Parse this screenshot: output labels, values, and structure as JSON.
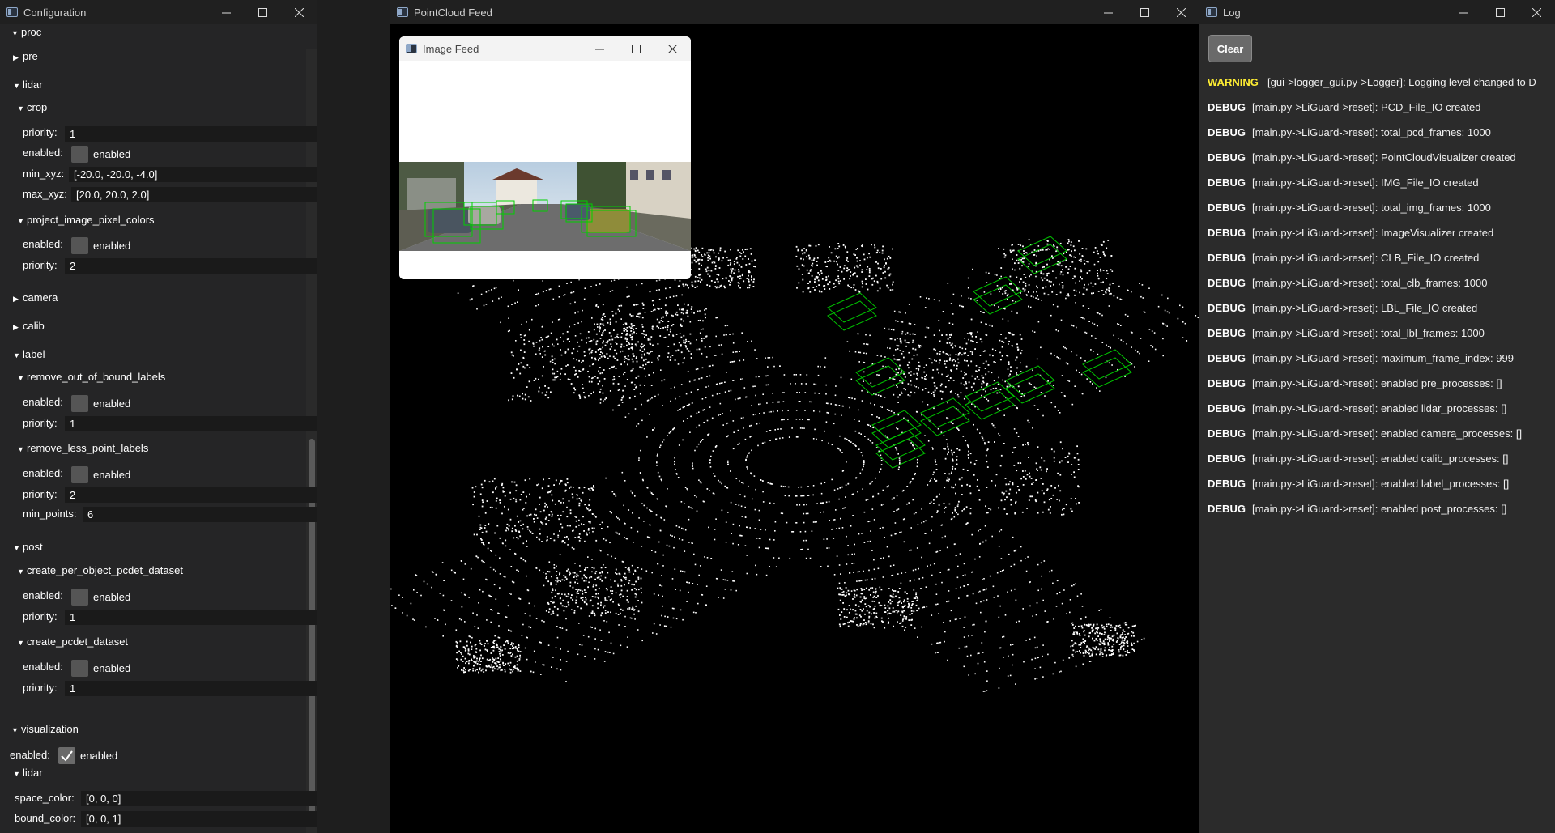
{
  "config_window": {
    "title": "Configuration",
    "sections": {
      "proc": "proc",
      "pre": "pre",
      "lidar": "lidar",
      "crop": "crop",
      "crop_priority_label": "priority:",
      "crop_priority": "1",
      "crop_enabled_label": "enabled:",
      "crop_enabled_text": "enabled",
      "min_xyz_label": "min_xyz:",
      "min_xyz": "[-20.0, -20.0, -4.0]",
      "max_xyz_label": "max_xyz:",
      "max_xyz": "[20.0, 20.0, 2.0]",
      "project_image_pixel_colors": "project_image_pixel_colors",
      "pipc_enabled_label": "enabled:",
      "pipc_enabled_text": "enabled",
      "pipc_priority_label": "priority:",
      "pipc_priority": "2",
      "camera": "camera",
      "calib": "calib",
      "label": "label",
      "remove_out_of_bound_labels": "remove_out_of_bound_labels",
      "roobl_enabled_label": "enabled:",
      "roobl_enabled_text": "enabled",
      "roobl_priority_label": "priority:",
      "roobl_priority": "1",
      "remove_less_point_labels": "remove_less_point_labels",
      "rlpl_enabled_label": "enabled:",
      "rlpl_enabled_text": "enabled",
      "rlpl_priority_label": "priority:",
      "rlpl_priority": "2",
      "min_points_label": "min_points:",
      "min_points": "6",
      "post": "post",
      "create_per_object_pcdet_dataset": "create_per_object_pcdet_dataset",
      "cpopd_enabled_label": "enabled:",
      "cpopd_enabled_text": "enabled",
      "cpopd_priority_label": "priority:",
      "cpopd_priority": "1",
      "create_pcdet_dataset": "create_pcdet_dataset",
      "cpd_enabled_label": "enabled:",
      "cpd_enabled_text": "enabled",
      "cpd_priority_label": "priority:",
      "cpd_priority": "1",
      "visualization": "visualization",
      "vis_enabled_label": "enabled:",
      "vis_enabled_text": "enabled",
      "vis_lidar": "lidar",
      "space_color_label": "space_color:",
      "space_color": "[0, 0, 0]",
      "bound_color_label": "bound_color:",
      "bound_color": "[0, 0, 1]"
    }
  },
  "pointcloud_window": {
    "title": "PointCloud Feed"
  },
  "image_window": {
    "title": "Image Feed"
  },
  "log_window": {
    "title": "Log",
    "clear_label": "Clear",
    "lines": [
      {
        "level": "WARNING",
        "msg": "[gui->logger_gui.py->Logger]: Logging level changed to D"
      },
      {
        "level": "DEBUG",
        "msg": "[main.py->LiGuard->reset]: PCD_File_IO created"
      },
      {
        "level": "DEBUG",
        "msg": "[main.py->LiGuard->reset]: total_pcd_frames: 1000"
      },
      {
        "level": "DEBUG",
        "msg": "[main.py->LiGuard->reset]: PointCloudVisualizer created"
      },
      {
        "level": "DEBUG",
        "msg": "[main.py->LiGuard->reset]: IMG_File_IO created"
      },
      {
        "level": "DEBUG",
        "msg": "[main.py->LiGuard->reset]: total_img_frames: 1000"
      },
      {
        "level": "DEBUG",
        "msg": "[main.py->LiGuard->reset]: ImageVisualizer created"
      },
      {
        "level": "DEBUG",
        "msg": "[main.py->LiGuard->reset]: CLB_File_IO created"
      },
      {
        "level": "DEBUG",
        "msg": "[main.py->LiGuard->reset]: total_clb_frames: 1000"
      },
      {
        "level": "DEBUG",
        "msg": "[main.py->LiGuard->reset]: LBL_File_IO created"
      },
      {
        "level": "DEBUG",
        "msg": "[main.py->LiGuard->reset]: total_lbl_frames: 1000"
      },
      {
        "level": "DEBUG",
        "msg": "[main.py->LiGuard->reset]: maximum_frame_index: 999"
      },
      {
        "level": "DEBUG",
        "msg": "[main.py->LiGuard->reset]: enabled pre_processes: []"
      },
      {
        "level": "DEBUG",
        "msg": "[main.py->LiGuard->reset]: enabled lidar_processes: []"
      },
      {
        "level": "DEBUG",
        "msg": "[main.py->LiGuard->reset]: enabled camera_processes: []"
      },
      {
        "level": "DEBUG",
        "msg": "[main.py->LiGuard->reset]: enabled calib_processes: []"
      },
      {
        "level": "DEBUG",
        "msg": "[main.py->LiGuard->reset]: enabled label_processes: []"
      },
      {
        "level": "DEBUG",
        "msg": "[main.py->LiGuard->reset]: enabled post_processes: []"
      }
    ]
  },
  "colors": {
    "warning": "#ffee33",
    "bbox": "#00c000",
    "background": "#000000"
  }
}
